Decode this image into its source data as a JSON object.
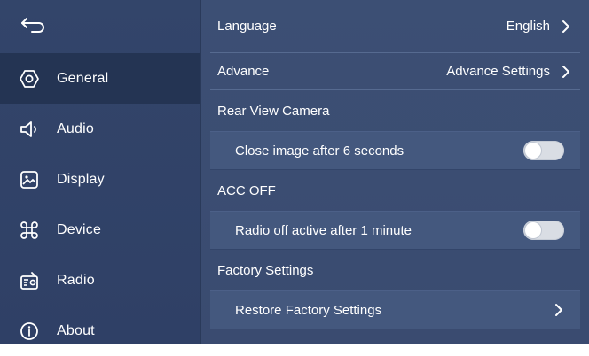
{
  "sidebar": {
    "back_icon": "back-arrow-icon",
    "items": [
      {
        "label": "General",
        "icon": "general-icon",
        "active": true
      },
      {
        "label": "Audio",
        "icon": "speaker-icon",
        "active": false
      },
      {
        "label": "Display",
        "icon": "image-icon",
        "active": false
      },
      {
        "label": "Device",
        "icon": "command-icon",
        "active": false
      },
      {
        "label": "Radio",
        "icon": "radio-icon",
        "active": false
      },
      {
        "label": "About",
        "icon": "info-icon",
        "active": false
      }
    ]
  },
  "main": {
    "language": {
      "label": "Language",
      "value": "English"
    },
    "advance": {
      "label": "Advance",
      "value": "Advance Settings"
    },
    "rear_camera": {
      "title": "Rear View Camera",
      "option_label": "Close image after 6 seconds",
      "toggle_on": false
    },
    "acc_off": {
      "title": "ACC OFF",
      "option_label": "Radio off active after 1 minute",
      "toggle_on": false
    },
    "factory": {
      "title": "Factory Settings",
      "restore_label": "Restore Factory Settings"
    }
  },
  "colors": {
    "sidebar_bg": "#33456a",
    "sidebar_active": "#243453",
    "main_bg": "#3c4f74",
    "card_bg": "#44587e",
    "toggle_off": "#d9dde4"
  }
}
